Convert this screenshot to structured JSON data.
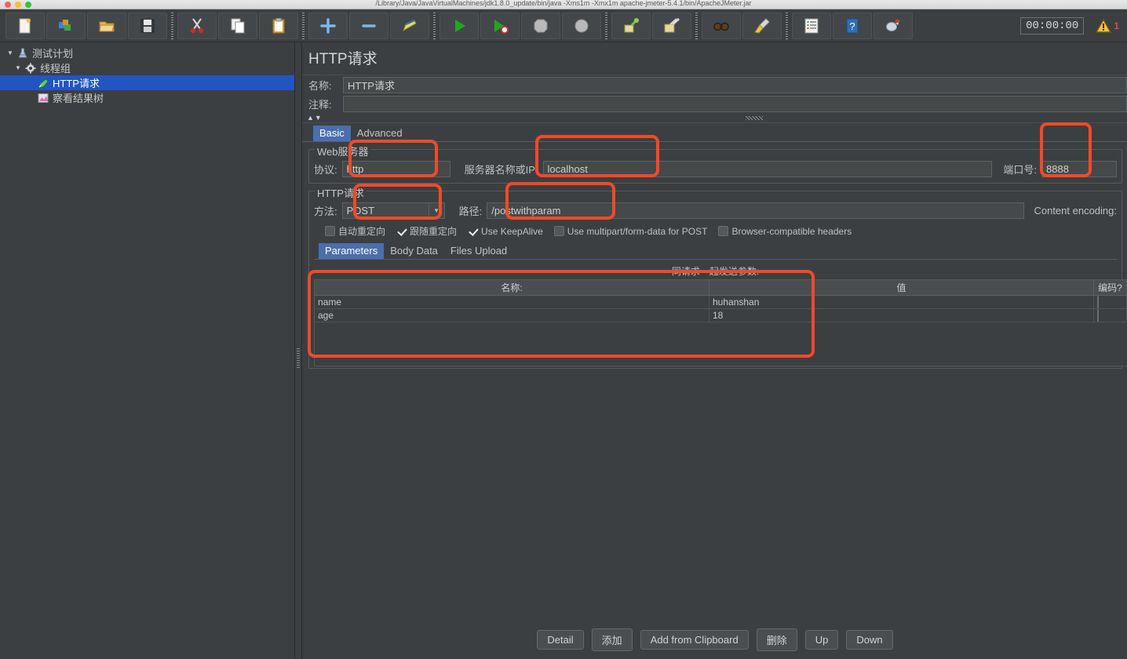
{
  "window": {
    "title": "/Library/Java/JavaVirtualMachines/jdk1.8.0_update/bin/java  -Xms1m -Xmx1m  apache-jmeter-5.4.1/bin/ApacheJMeter.jar"
  },
  "toolbar": {
    "buttons": [
      {
        "name": "new-button",
        "label": "New",
        "icon": "new-file-icon"
      },
      {
        "name": "templates-button",
        "label": "Templates",
        "icon": "templates-icon"
      },
      {
        "name": "open-button",
        "label": "Open",
        "icon": "open-folder-icon"
      },
      {
        "name": "save-button",
        "label": "Save",
        "icon": "save-disk-icon"
      },
      {
        "name": "cut-button",
        "label": "Cut",
        "icon": "scissors-icon"
      },
      {
        "name": "copy-button",
        "label": "Copy",
        "icon": "copy-pages-icon"
      },
      {
        "name": "paste-button",
        "label": "Paste",
        "icon": "clipboard-icon"
      },
      {
        "name": "expand-all-button",
        "label": "Expand All",
        "icon": "plus-icon"
      },
      {
        "name": "collapse-all-button",
        "label": "Collapse All",
        "icon": "minus-icon"
      },
      {
        "name": "toggle-button",
        "label": "Toggle",
        "icon": "toggle-pencil-icon"
      },
      {
        "name": "start-button",
        "label": "Start",
        "icon": "play-green-icon"
      },
      {
        "name": "start-no-pauses-button",
        "label": "Start no pauses",
        "icon": "play-no-pause-icon"
      },
      {
        "name": "stop-button",
        "label": "Stop",
        "icon": "stop-octagon-icon"
      },
      {
        "name": "shutdown-button",
        "label": "Shutdown",
        "icon": "shutdown-circle-icon"
      },
      {
        "name": "clear-button",
        "label": "Clear",
        "icon": "clear-broom-icon"
      },
      {
        "name": "clear-all-button",
        "label": "Clear All",
        "icon": "clear-all-broom-icon"
      },
      {
        "name": "search-button",
        "label": "Search",
        "icon": "binoculars-icon"
      },
      {
        "name": "reset-search-button",
        "label": "Reset Search",
        "icon": "brush-icon"
      },
      {
        "name": "function-helper-button",
        "label": "Function Helper Dialog",
        "icon": "function-list-icon"
      },
      {
        "name": "help-button",
        "label": "Help",
        "icon": "help-book-icon"
      },
      {
        "name": "undo-redo-button",
        "label": "Templates",
        "icon": "bird-icon"
      }
    ],
    "timer": "00:00:00",
    "warning_count": "1"
  },
  "sidebar": {
    "items": [
      {
        "label": "测试计划",
        "icon": "test-plan-icon",
        "twisty": "▼",
        "depth": 0,
        "selected": false
      },
      {
        "label": "线程组",
        "icon": "thread-group-gear-icon",
        "twisty": "▼",
        "depth": 1,
        "selected": false
      },
      {
        "label": "HTTP请求",
        "icon": "http-request-icon",
        "twisty": "",
        "depth": 2,
        "selected": true
      },
      {
        "label": "察看结果树",
        "icon": "view-results-tree-icon",
        "twisty": "",
        "depth": 2,
        "selected": false
      }
    ]
  },
  "main": {
    "title": "HTTP请求",
    "name_label": "名称:",
    "name_value": "HTTP请求",
    "comment_label": "注释:",
    "comment_value": "",
    "tabs": [
      {
        "label": "Basic",
        "active": true
      },
      {
        "label": "Advanced",
        "active": false
      }
    ],
    "web_server": {
      "group_title": "Web服务器",
      "protocol_label": "协议:",
      "protocol_value": "http",
      "server_label": "服务器名称或IP:",
      "server_value": "localhost",
      "port_label": "端口号:",
      "port_value": "8888"
    },
    "http_request": {
      "group_title": "HTTP请求",
      "method_label": "方法:",
      "method_value": "POST",
      "path_label": "路径:",
      "path_value": "/postwithparam",
      "content_encoding_label": "Content encoding:",
      "content_encoding_value": "",
      "checkboxes": [
        {
          "label": "自动重定向",
          "checked": false
        },
        {
          "label": "跟随重定向",
          "checked": true
        },
        {
          "label": "Use KeepAlive",
          "checked": true
        },
        {
          "label": "Use multipart/form-data for POST",
          "checked": false
        },
        {
          "label": "Browser-compatible headers",
          "checked": false
        }
      ]
    },
    "param_tabs": [
      {
        "label": "Parameters",
        "active": true
      },
      {
        "label": "Body Data",
        "active": false
      },
      {
        "label": "Files Upload",
        "active": false
      }
    ],
    "params_table": {
      "caption": "同请求一起发送参数:",
      "columns": [
        "名称:",
        "值",
        "编码?"
      ],
      "rows": [
        {
          "name": "name",
          "value": "huhanshan",
          "encode": false
        },
        {
          "name": "age",
          "value": "18",
          "encode": false
        }
      ]
    },
    "buttons": [
      {
        "name": "detail-button",
        "label": "Detail"
      },
      {
        "name": "add-button",
        "label": "添加"
      },
      {
        "name": "add-from-clipboard-button",
        "label": "Add from Clipboard"
      },
      {
        "name": "delete-button",
        "label": "删除"
      },
      {
        "name": "up-button",
        "label": "Up"
      },
      {
        "name": "down-button",
        "label": "Down"
      }
    ]
  },
  "annotations": {
    "color": "#f04a28",
    "boxes": [
      {
        "name": "protocol-highlight"
      },
      {
        "name": "server-name-highlight"
      },
      {
        "name": "port-highlight"
      },
      {
        "name": "method-highlight"
      },
      {
        "name": "path-highlight"
      },
      {
        "name": "params-table-highlight"
      }
    ]
  }
}
